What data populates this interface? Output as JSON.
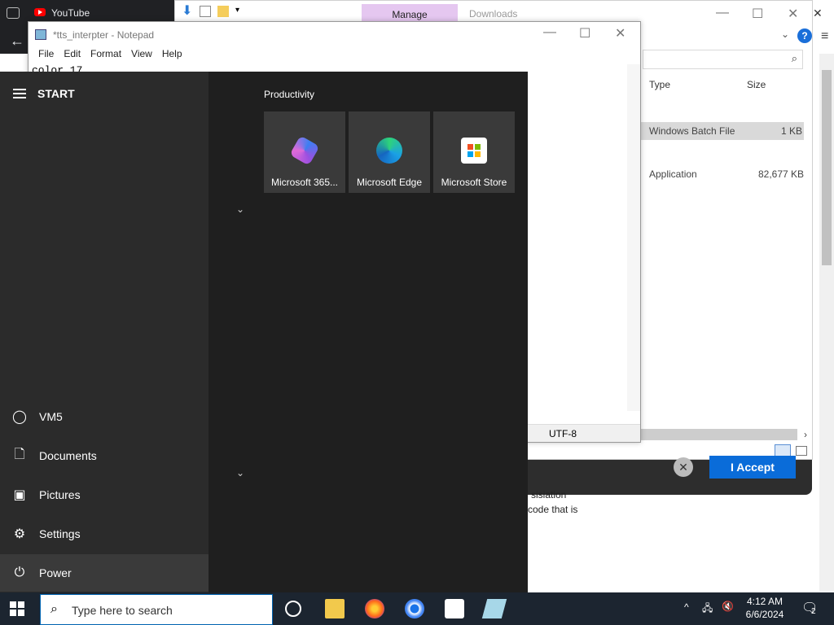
{
  "browser": {
    "tab_title": "YouTube"
  },
  "explorer": {
    "ribbon_tab_manage": "Manage",
    "window_title": "Downloads",
    "columns": [
      "Type",
      "Size"
    ],
    "rows": [
      {
        "type": "Windows Batch File",
        "size": "1 KB"
      },
      {
        "type": "Application",
        "size": "82,677 KB"
      }
    ],
    "help": "?"
  },
  "notepad": {
    "title": "*tts_interpter - Notepad",
    "menu": [
      "File",
      "Edit",
      "Format",
      "View",
      "Help"
    ],
    "content": "color 17",
    "encoding": "UTF-8"
  },
  "cookie": {
    "accept_label": "I Accept",
    "close": "✕",
    "text_1": "sisiation",
    "text_2": "code that is"
  },
  "start_menu": {
    "header": "START",
    "group_title": "Productivity",
    "tiles": [
      {
        "label": "Microsoft 365...",
        "icon": "microsoft-365-icon"
      },
      {
        "label": "Microsoft Edge",
        "icon": "edge-icon"
      },
      {
        "label": "Microsoft Store",
        "icon": "store-icon"
      }
    ],
    "left_items": [
      {
        "label": "VM5",
        "icon": "user-icon"
      },
      {
        "label": "Documents",
        "icon": "document-icon"
      },
      {
        "label": "Pictures",
        "icon": "pictures-icon"
      },
      {
        "label": "Settings",
        "icon": "gear-icon"
      },
      {
        "label": "Power",
        "icon": "power-icon"
      }
    ]
  },
  "taskbar": {
    "search_placeholder": "Type here to search",
    "time": "4:12 AM",
    "date": "6/6/2024",
    "notification_count": "2"
  },
  "colors": {
    "start_bg": "#1f1f1f",
    "start_left": "#2b2b2b",
    "accent": "#0a6cd9",
    "manage_tab": "#e5c7f0"
  }
}
